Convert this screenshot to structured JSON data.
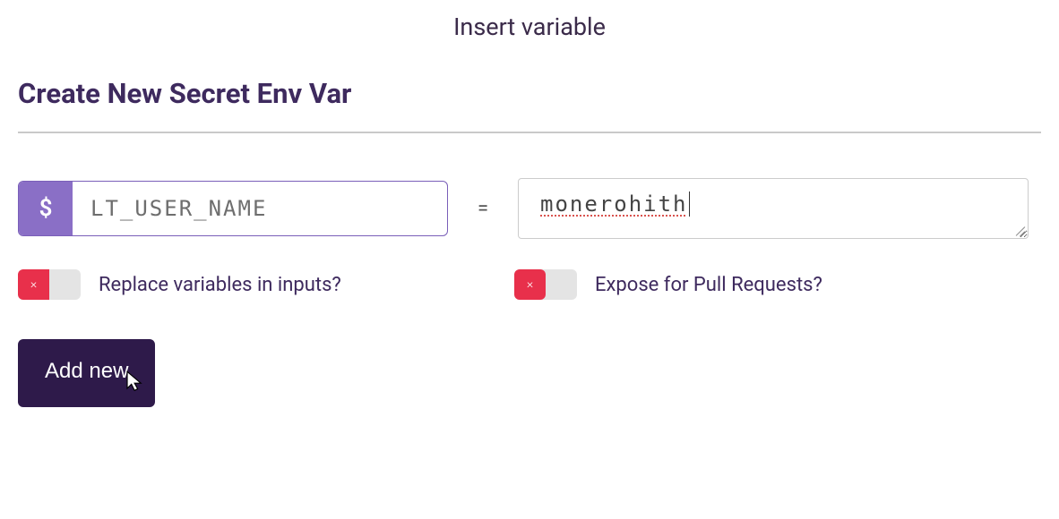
{
  "header": {
    "title": "Insert variable"
  },
  "section": {
    "title": "Create New Secret Env Var"
  },
  "form": {
    "key_prefix": "$",
    "key_value": "LT_USER_NAME",
    "equals": "=",
    "value_value": "monerohith"
  },
  "toggles": {
    "replace": {
      "label": "Replace variables in inputs?",
      "state": false,
      "icon": "×"
    },
    "expose": {
      "label": "Expose for Pull Requests?",
      "state": false,
      "icon": "×"
    }
  },
  "actions": {
    "add_label": "Add new"
  }
}
